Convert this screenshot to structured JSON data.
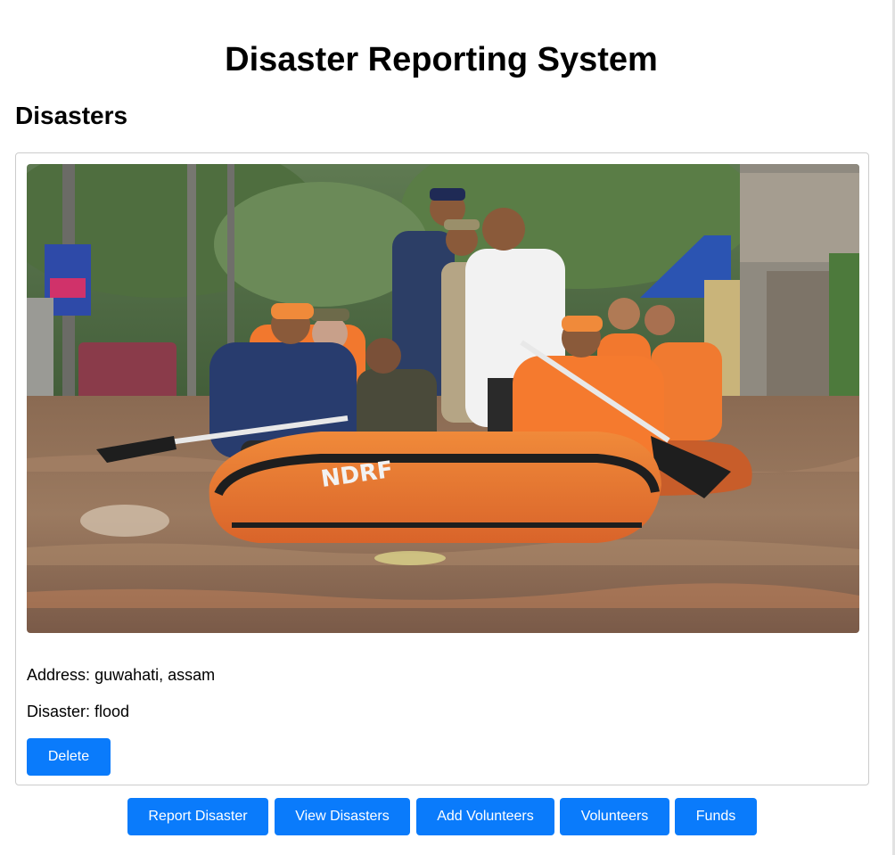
{
  "header": {
    "title": "Disaster Reporting System"
  },
  "section": {
    "title": "Disasters"
  },
  "disaster_card": {
    "address_label": "Address:",
    "address_value": "guwahati, assam",
    "disaster_label": "Disaster:",
    "disaster_value": "flood",
    "delete_label": "Delete",
    "boat_lettering": "NDRF"
  },
  "nav": {
    "report_disaster": "Report Disaster",
    "view_disasters": "View Disasters",
    "add_volunteers": "Add Volunteers",
    "volunteers": "Volunteers",
    "funds": "Funds"
  },
  "colors": {
    "accent": "#0a7bfb",
    "button_text": "#ffffff",
    "card_border": "#cccccc"
  }
}
